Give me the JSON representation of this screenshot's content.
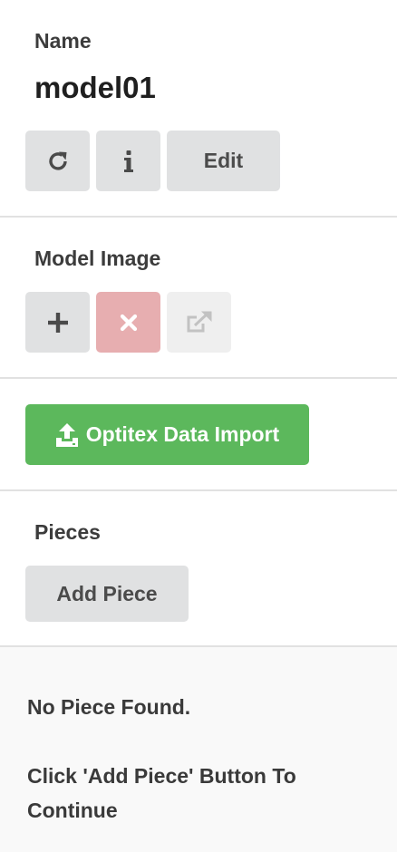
{
  "name_section": {
    "label": "Name",
    "value": "model01",
    "edit_label": "Edit",
    "refresh_icon": "refresh-icon",
    "info_icon": "info-icon"
  },
  "image_section": {
    "label": "Model Image",
    "add_icon": "plus-icon",
    "remove_icon": "close-icon",
    "open_icon": "external-link-icon"
  },
  "import": {
    "label": "Optitex Data Import",
    "icon": "upload-icon",
    "color": "#5cb85c"
  },
  "pieces": {
    "label": "Pieces",
    "add_label": "Add Piece"
  },
  "empty_state": {
    "title": "No Piece Found.",
    "message": "Click 'Add Piece' Button To Continue"
  },
  "colors": {
    "button_gray": "#e0e1e2",
    "danger_light": "#e7aeb0",
    "disabled": "#efefef",
    "divider": "#e1e1e1"
  }
}
